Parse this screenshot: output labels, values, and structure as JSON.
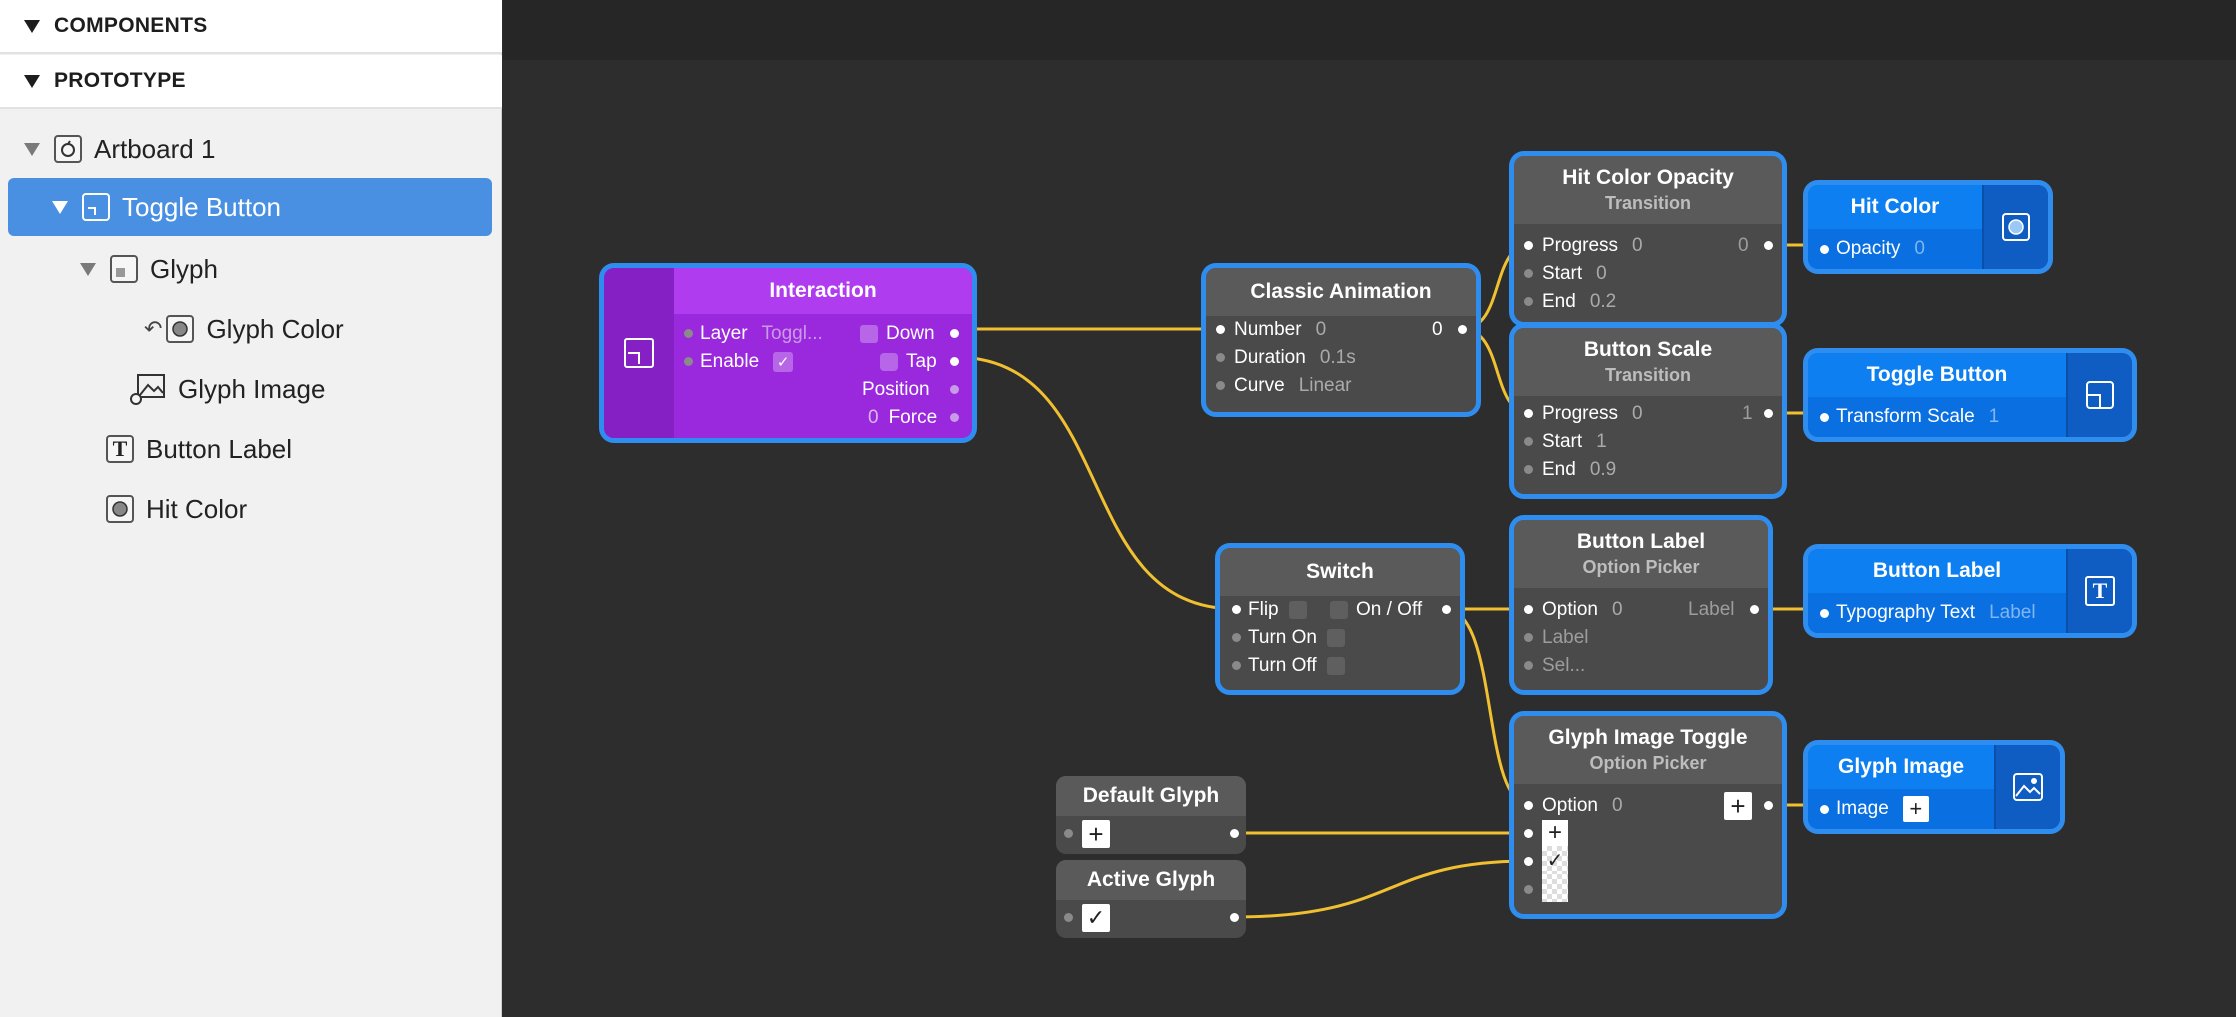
{
  "sidebar": {
    "components_title": "COMPONENTS",
    "prototype_title": "PROTOTYPE",
    "layers": [
      {
        "label": "Artboard 1"
      },
      {
        "label": "Toggle Button"
      },
      {
        "label": "Glyph"
      },
      {
        "label": "Glyph Color"
      },
      {
        "label": "Glyph Image"
      },
      {
        "label": "Button Label"
      },
      {
        "label": "Hit Color"
      }
    ]
  },
  "nodes": {
    "interaction": {
      "title": "Interaction",
      "layer_label": "Layer",
      "layer_value": "Toggl...",
      "enable_label": "Enable",
      "down_label": "Down",
      "tap_label": "Tap",
      "position_label": "Position",
      "force_label": "Force",
      "force_value": "0"
    },
    "classic_animation": {
      "title": "Classic Animation",
      "number_label": "Number",
      "number_value": "0",
      "out_value": "0",
      "duration_label": "Duration",
      "duration_value": "0.1s",
      "curve_label": "Curve",
      "curve_value": "Linear"
    },
    "hit_color_opacity": {
      "title": "Hit Color Opacity",
      "subtitle": "Transition",
      "progress_label": "Progress",
      "progress_value": "0",
      "out_value": "0",
      "start_label": "Start",
      "start_value": "0",
      "end_label": "End",
      "end_value": "0.2"
    },
    "button_scale": {
      "title": "Button Scale",
      "subtitle": "Transition",
      "progress_label": "Progress",
      "progress_value": "0",
      "out_value": "1",
      "start_label": "Start",
      "start_value": "1",
      "end_label": "End",
      "end_value": "0.9"
    },
    "switch": {
      "title": "Switch",
      "flip_label": "Flip",
      "onoff_label": "On / Off",
      "turn_on_label": "Turn On",
      "turn_off_label": "Turn Off"
    },
    "button_label_picker": {
      "title": "Button Label",
      "subtitle": "Option Picker",
      "option_label": "Option",
      "option_value": "0",
      "out_label": "Label",
      "item1": "Label",
      "item2": "Sel..."
    },
    "glyph_image_toggle": {
      "title": "Glyph Image Toggle",
      "subtitle": "Option Picker",
      "option_label": "Option",
      "option_value": "0"
    },
    "default_glyph": {
      "title": "Default Glyph"
    },
    "active_glyph": {
      "title": "Active Glyph"
    },
    "hit_color_out": {
      "title": "Hit Color",
      "prop_label": "Opacity",
      "prop_value": "0"
    },
    "toggle_button_out": {
      "title": "Toggle Button",
      "prop_label": "Transform Scale",
      "prop_value": "1"
    },
    "button_label_out": {
      "title": "Button Label",
      "prop_label": "Typography Text",
      "prop_value": "Label"
    },
    "glyph_image_out": {
      "title": "Glyph Image",
      "prop_label": "Image"
    }
  },
  "colors": {
    "wire": "#f0c030",
    "highlight": "#2f8df0",
    "interaction_purple": "#a032e8",
    "selection": "#4990e2"
  },
  "icons": [
    "layer-square-icon",
    "camera-icon",
    "circle-fill-icon",
    "image-icon",
    "text-T-icon",
    "plus-icon",
    "checkmark-icon"
  ]
}
